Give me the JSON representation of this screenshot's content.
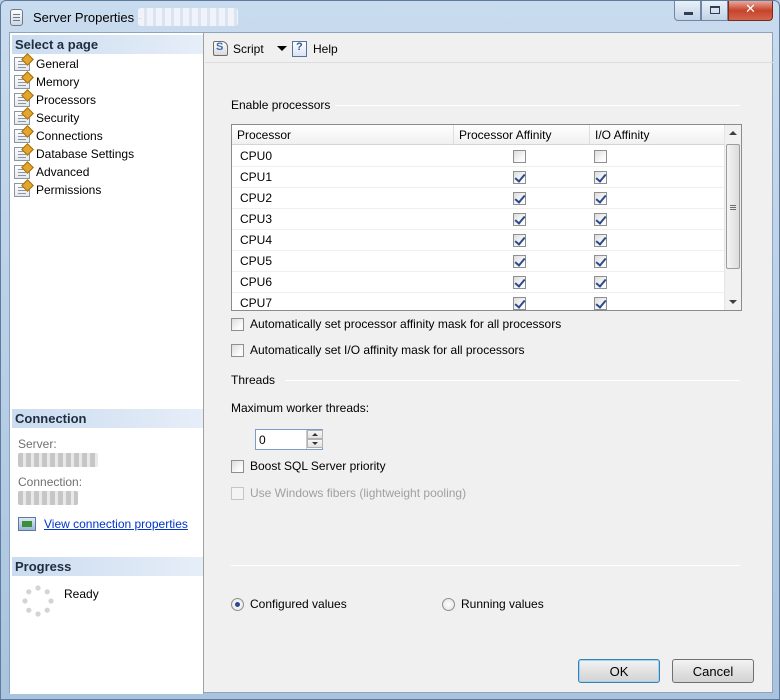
{
  "window": {
    "title": "Server Properties - ",
    "title_blurred": "",
    "caption": {
      "minimize": "",
      "maximize": "",
      "close": "✕"
    }
  },
  "sidebar": {
    "select_page_header": "Select a page",
    "pages": [
      {
        "label": "General"
      },
      {
        "label": "Memory"
      },
      {
        "label": "Processors"
      },
      {
        "label": "Security"
      },
      {
        "label": "Connections"
      },
      {
        "label": "Database Settings"
      },
      {
        "label": "Advanced"
      },
      {
        "label": "Permissions"
      }
    ],
    "connection_header": "Connection",
    "server_label": "Server:",
    "connection_label": "Connection:",
    "view_connection_link": "View connection properties",
    "progress_header": "Progress",
    "progress_status": "Ready"
  },
  "toolbar": {
    "script_label": "Script",
    "help_label": "Help"
  },
  "processors": {
    "enable_group_label": "Enable processors",
    "columns": [
      "Processor",
      "Processor Affinity",
      "I/O Affinity"
    ],
    "rows": [
      {
        "name": "CPU0",
        "processor_affinity": false,
        "io_affinity": false
      },
      {
        "name": "CPU1",
        "processor_affinity": true,
        "io_affinity": true
      },
      {
        "name": "CPU2",
        "processor_affinity": true,
        "io_affinity": true
      },
      {
        "name": "CPU3",
        "processor_affinity": true,
        "io_affinity": true
      },
      {
        "name": "CPU4",
        "processor_affinity": true,
        "io_affinity": true
      },
      {
        "name": "CPU5",
        "processor_affinity": true,
        "io_affinity": true
      },
      {
        "name": "CPU6",
        "processor_affinity": true,
        "io_affinity": true
      },
      {
        "name": "CPU7",
        "processor_affinity": true,
        "io_affinity": true
      }
    ],
    "auto_processor_affinity_label": "Automatically set processor affinity mask for all processors",
    "auto_processor_affinity_checked": false,
    "auto_io_affinity_label": "Automatically set I/O affinity mask for all processors",
    "auto_io_affinity_checked": false
  },
  "threads": {
    "group_label": "Threads",
    "max_worker_label": "Maximum worker threads:",
    "max_worker_value": "0",
    "boost_priority_label": "Boost SQL Server priority",
    "boost_priority_checked": false,
    "windows_fibers_label": "Use Windows fibers (lightweight pooling)",
    "windows_fibers_checked": false,
    "windows_fibers_enabled": false
  },
  "values_mode": {
    "configured_label": "Configured  values",
    "running_label": "Running values",
    "selected": "configured"
  },
  "buttons": {
    "ok_label": "OK",
    "cancel_label": "Cancel"
  },
  "colors": {
    "title_gradient": "#c9dcef",
    "section_header": "#cbdcf0",
    "link": "#0033cc",
    "check_mark": "#2b4a8c"
  }
}
